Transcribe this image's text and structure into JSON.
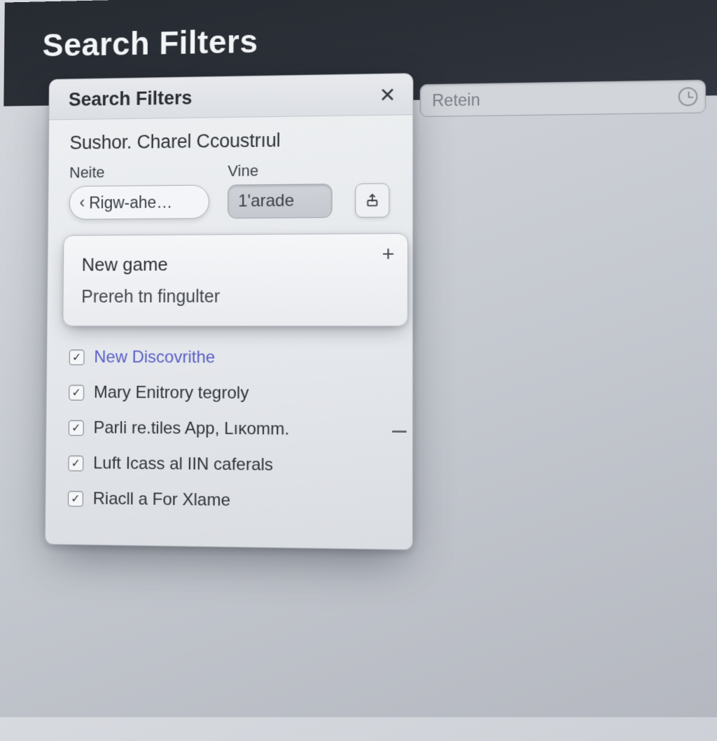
{
  "header": {
    "title": "Search Filters"
  },
  "retain": {
    "placeholder": "Retein"
  },
  "panel": {
    "title": "Search Filters",
    "subtitle": "Sushor. Charel Ccoustrıul",
    "cols": {
      "neite": {
        "label": "Neite",
        "value": "Rigw-ahe…"
      },
      "vine": {
        "label": "Vine",
        "value": "1'arade"
      }
    },
    "card": {
      "line1": "New game",
      "line2": "Prereh tn fingulter",
      "add": "+"
    },
    "checklist": [
      {
        "label": "New Discovrithe",
        "checked": true,
        "link": true
      },
      {
        "label": "Mary Enitrory tegroly",
        "checked": true,
        "link": false
      },
      {
        "label": "Parli re.tiles App, Lıĸomm.",
        "checked": true,
        "link": false
      },
      {
        "label": "Luft Icass al IIN caferals",
        "checked": true,
        "link": false
      },
      {
        "label": "Riacll a For Xlame",
        "checked": true,
        "link": false
      }
    ],
    "collapse": "–"
  },
  "icons": {
    "close": "✕",
    "check": "✓",
    "chevron_left": "‹"
  }
}
